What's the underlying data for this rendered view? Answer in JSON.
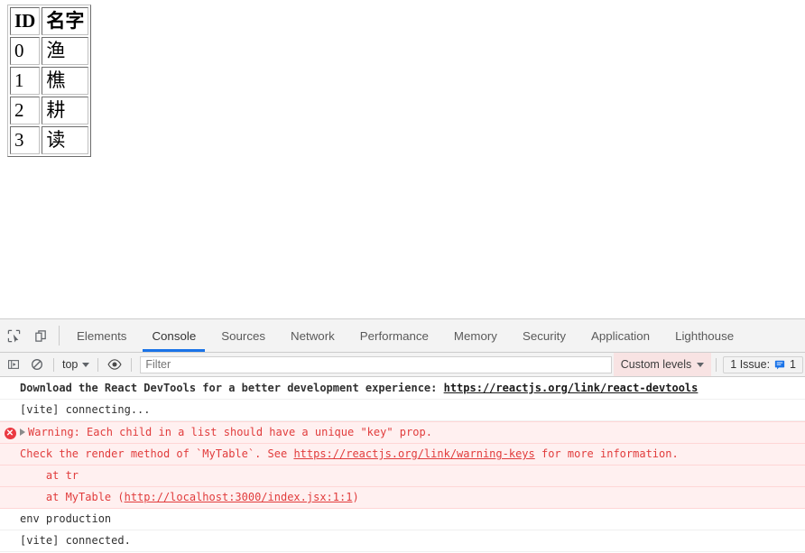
{
  "page": {
    "table": {
      "headers": [
        "ID",
        "名字"
      ],
      "rows": [
        [
          "0",
          "渔"
        ],
        [
          "1",
          "樵"
        ],
        [
          "2",
          "耕"
        ],
        [
          "3",
          "读"
        ]
      ]
    }
  },
  "devtools": {
    "tabs": [
      {
        "label": "Elements",
        "active": false
      },
      {
        "label": "Console",
        "active": true
      },
      {
        "label": "Sources",
        "active": false
      },
      {
        "label": "Network",
        "active": false
      },
      {
        "label": "Performance",
        "active": false
      },
      {
        "label": "Memory",
        "active": false
      },
      {
        "label": "Security",
        "active": false
      },
      {
        "label": "Application",
        "active": false
      },
      {
        "label": "Lighthouse",
        "active": false
      }
    ],
    "toolbar": {
      "context": "top",
      "filter_placeholder": "Filter",
      "filter_value": "",
      "levels_label": "Custom levels",
      "issues_label": "1 Issue:",
      "issues_count": "1"
    },
    "console": {
      "messages": [
        {
          "id": "react-devtools",
          "level": "info",
          "bold": true,
          "text": "Download the React DevTools for a better development experience: ",
          "link": "https://reactjs.org/link/react-devtools",
          "tail": ""
        },
        {
          "id": "vite-connecting",
          "level": "info",
          "bold": false,
          "text": "[vite] connecting...",
          "link": "",
          "tail": ""
        },
        {
          "id": "react-key-warning",
          "level": "error",
          "bold": false,
          "text": "Warning: Each child in a list should have a unique \"key\" prop.",
          "link": "",
          "tail": ""
        },
        {
          "id": "react-key-warning-detail",
          "level": "error",
          "bold": false,
          "text": "Check the render method of `MyTable`. See ",
          "link": "https://reactjs.org/link/warning-keys",
          "tail": " for more information."
        },
        {
          "id": "stack-tr",
          "level": "error",
          "bold": false,
          "text": "    at tr",
          "link": "",
          "tail": ""
        },
        {
          "id": "stack-mytable",
          "level": "error",
          "bold": false,
          "text": "    at MyTable (",
          "link": "http://localhost:3000/index.jsx:1:1",
          "tail": ")"
        },
        {
          "id": "env-production",
          "level": "info",
          "bold": false,
          "text": "env production",
          "link": "",
          "tail": ""
        },
        {
          "id": "vite-connected",
          "level": "info",
          "bold": false,
          "text": "[vite] connected.",
          "link": "",
          "tail": ""
        }
      ]
    },
    "icons": {
      "inspect": "inspect-element-icon",
      "device": "device-toolbar-icon",
      "sidebar": "console-sidebar-icon",
      "clear": "clear-console-icon",
      "eye": "live-expression-icon",
      "issue": "issue-note-icon"
    },
    "colors": {
      "accent": "#1a73e8",
      "error": "#e13c3c",
      "error_bg": "#fff0f0",
      "toolbar_bg": "#f3f3f3"
    }
  }
}
